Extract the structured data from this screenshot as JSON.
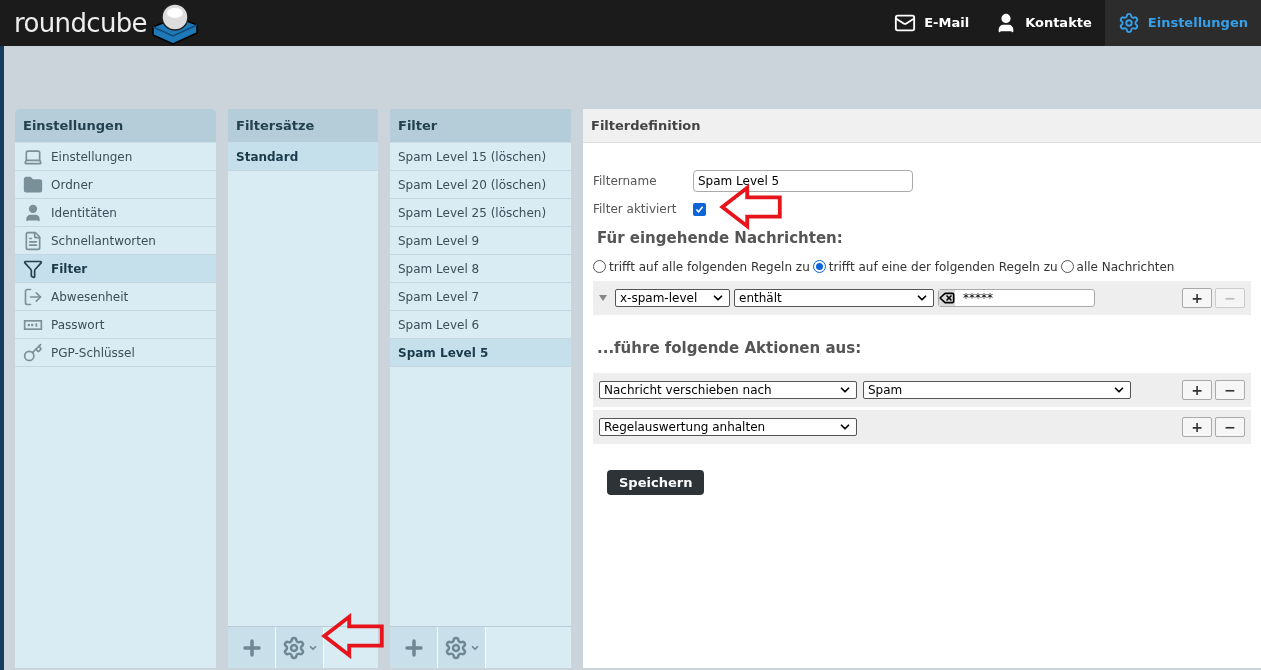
{
  "header": {
    "logo": "roundcube",
    "nav": [
      {
        "label": "E-Mail",
        "kind": "mail",
        "selected": false
      },
      {
        "label": "Kontakte",
        "kind": "person",
        "selected": false
      },
      {
        "label": "Einstellungen",
        "kind": "gear",
        "selected": true
      }
    ]
  },
  "settings_panel": {
    "title": "Einstellungen",
    "items": [
      {
        "label": "Einstellungen",
        "kind": "laptop",
        "selected": false
      },
      {
        "label": "Ordner",
        "kind": "folder",
        "selected": false
      },
      {
        "label": "Identitäten",
        "kind": "person",
        "selected": false
      },
      {
        "label": "Schnellantworten",
        "kind": "file",
        "selected": false
      },
      {
        "label": "Filter",
        "kind": "funnel",
        "selected": true
      },
      {
        "label": "Abwesenheit",
        "kind": "exit",
        "selected": false
      },
      {
        "label": "Passwort",
        "kind": "password",
        "selected": false
      },
      {
        "label": "PGP-Schlüssel",
        "kind": "key",
        "selected": false
      }
    ]
  },
  "filtersets_panel": {
    "title": "Filtersätze",
    "items": [
      {
        "label": "Standard",
        "selected": true
      }
    ],
    "annotated_menu": true
  },
  "filters_panel": {
    "title": "Filter",
    "items": [
      {
        "label": "Spam Level 15 (löschen)",
        "selected": false
      },
      {
        "label": "Spam Level 20 (löschen)",
        "selected": false
      },
      {
        "label": "Spam Level 25 (löschen)",
        "selected": false
      },
      {
        "label": "Spam Level 9",
        "selected": false
      },
      {
        "label": "Spam Level 8",
        "selected": false
      },
      {
        "label": "Spam Level 7",
        "selected": false
      },
      {
        "label": "Spam Level 6",
        "selected": false
      },
      {
        "label": "Spam Level 5",
        "selected": true
      }
    ]
  },
  "definition": {
    "title": "Filterdefinition",
    "name_label": "Filtername",
    "name_value": "Spam Level 5",
    "enabled_label": "Filter aktiviert",
    "enabled_checked": true,
    "enabled_annotated": true,
    "rules_heading": "Für eingehende Nachrichten:",
    "match_options": [
      {
        "label": "trifft auf alle folgenden Regeln zu",
        "selected": false
      },
      {
        "label": "trifft auf eine der folgenden Regeln zu",
        "selected": true
      },
      {
        "label": "alle Nachrichten",
        "selected": false
      }
    ],
    "rules": [
      {
        "header": "x-spam-level",
        "operator": "enthält",
        "value": "*****",
        "remove_disabled": true
      }
    ],
    "actions_heading": "...führe folgende Aktionen aus:",
    "actions": [
      {
        "action": "Nachricht verschieben nach",
        "target": "Spam"
      },
      {
        "action": "Regelauswertung anhalten"
      }
    ],
    "add_label": "+",
    "remove_label": "−",
    "save_label": "Speichern"
  }
}
